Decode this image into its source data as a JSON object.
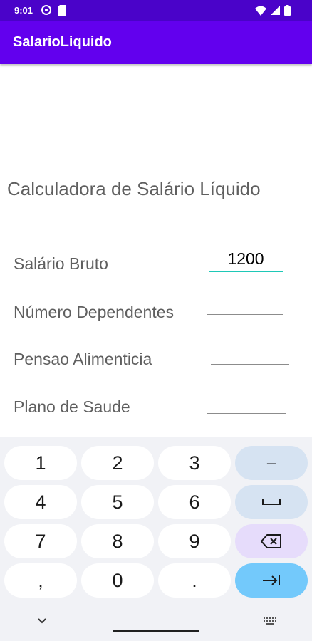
{
  "status_bar": {
    "time": "9:01",
    "left_icons": [
      "settings-icon",
      "sd-card-icon"
    ],
    "right_icons": [
      "wifi-icon",
      "signal-icon",
      "battery-icon"
    ]
  },
  "app_bar": {
    "title": "SalarioLiquido"
  },
  "main": {
    "heading": "Calculadora de Salário Líquido",
    "fields": [
      {
        "label": "Salário Bruto",
        "value": "1200",
        "focused": true
      },
      {
        "label": "Número Dependentes",
        "value": ""
      },
      {
        "label": "Pensao Alimenticia",
        "value": ""
      },
      {
        "label": "Plano de Saude",
        "value": ""
      }
    ]
  },
  "keyboard": {
    "rows": [
      [
        "1",
        "2",
        "3",
        "–"
      ],
      [
        "4",
        "5",
        "6",
        "space"
      ],
      [
        "7",
        "8",
        "9",
        "backspace"
      ],
      [
        ",",
        "0",
        ".",
        "next"
      ]
    ]
  },
  "colors": {
    "status_bar": "#4a03c9",
    "app_bar": "#6200ee",
    "focus_underline": "#1ec8b7",
    "next_key": "#73c9fb"
  }
}
